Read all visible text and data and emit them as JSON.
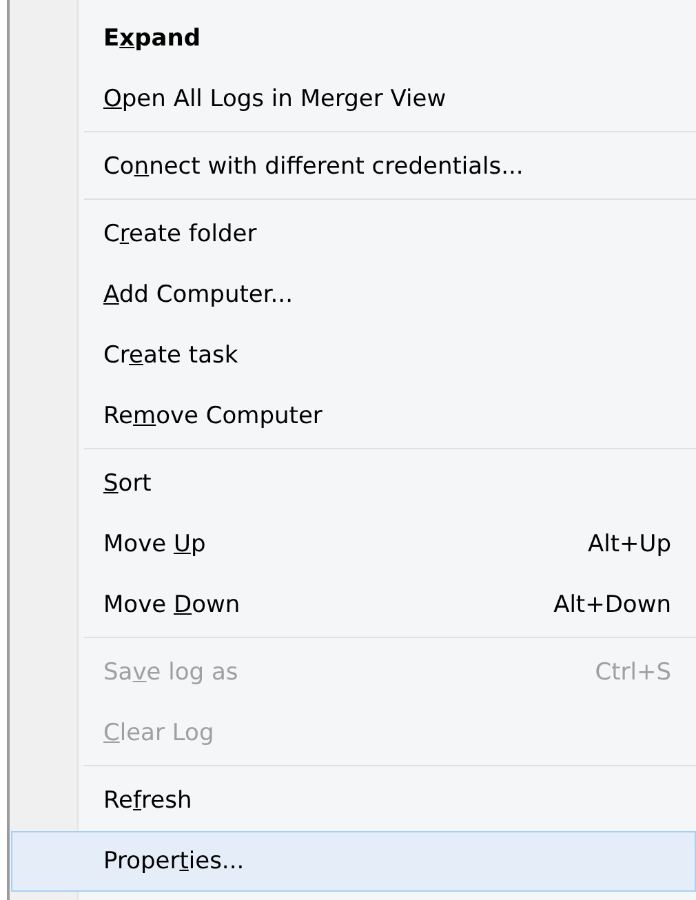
{
  "context_menu": {
    "items": [
      {
        "kind": "item",
        "text_before": "E",
        "access_key": "x",
        "text_after": "pand",
        "default": true,
        "disabled": false,
        "selected": false
      },
      {
        "kind": "item",
        "access_key": "O",
        "text_after": "pen All Logs in Merger View",
        "default": false,
        "disabled": false,
        "selected": false
      },
      {
        "kind": "separator"
      },
      {
        "kind": "item",
        "text_before": "Co",
        "access_key": "n",
        "text_after": "nect with different credentials...",
        "default": false,
        "disabled": false,
        "selected": false
      },
      {
        "kind": "separator"
      },
      {
        "kind": "item",
        "text_before": "C",
        "access_key": "r",
        "text_after": "eate folder",
        "default": false,
        "disabled": false,
        "selected": false
      },
      {
        "kind": "item",
        "access_key": "A",
        "text_after": "dd Computer...",
        "default": false,
        "disabled": false,
        "selected": false
      },
      {
        "kind": "item",
        "text_before": "Cr",
        "access_key": "e",
        "text_after": "ate task",
        "default": false,
        "disabled": false,
        "selected": false
      },
      {
        "kind": "item",
        "text_before": "Re",
        "access_key": "m",
        "text_after": "ove Computer",
        "default": false,
        "disabled": false,
        "selected": false
      },
      {
        "kind": "separator"
      },
      {
        "kind": "item",
        "access_key": "S",
        "text_after": "ort",
        "default": false,
        "disabled": false,
        "selected": false
      },
      {
        "kind": "item",
        "text_before": "Move ",
        "access_key": "U",
        "text_after": "p",
        "shortcut": "Alt+Up",
        "default": false,
        "disabled": false,
        "selected": false
      },
      {
        "kind": "item",
        "text_before": "Move ",
        "access_key": "D",
        "text_after": "own",
        "shortcut": "Alt+Down",
        "default": false,
        "disabled": false,
        "selected": false
      },
      {
        "kind": "separator"
      },
      {
        "kind": "item",
        "text_before": "Sa",
        "access_key": "v",
        "text_after": "e log as",
        "shortcut": "Ctrl+S",
        "default": false,
        "disabled": true,
        "selected": false
      },
      {
        "kind": "item",
        "access_key": "C",
        "text_after": "lear Log",
        "default": false,
        "disabled": true,
        "selected": false
      },
      {
        "kind": "separator"
      },
      {
        "kind": "item",
        "text_before": "Re",
        "access_key": "f",
        "text_after": "resh",
        "default": false,
        "disabled": false,
        "selected": false
      },
      {
        "kind": "item",
        "text_before": "Proper",
        "access_key": "t",
        "text_after": "ies...",
        "default": false,
        "disabled": false,
        "selected": true
      }
    ]
  }
}
